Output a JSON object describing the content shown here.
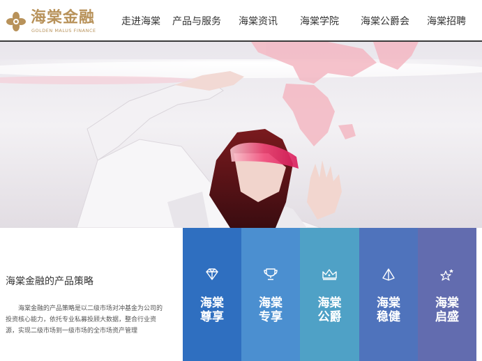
{
  "logo": {
    "name_cn": "海棠金融",
    "name_en": "GOLDEN MALUS FINANCE"
  },
  "nav": [
    {
      "label": "走进海棠"
    },
    {
      "label": "产品与服务"
    },
    {
      "label": "海棠资讯"
    },
    {
      "label": "海棠学院"
    },
    {
      "label": "海棠公爵会"
    },
    {
      "label": "海棠招聘"
    }
  ],
  "strategy": {
    "title": "海棠金融的产品策略",
    "text": "海棠金融的产品策略是以二级市场对冲基金为公司的投资核心能力，依托专业私募投顾大数据，整合行业资源，实现二级市场到一级市场的全市场资产管理"
  },
  "products": [
    {
      "line1": "海棠",
      "line2": "尊享",
      "icon": "diamond-icon",
      "color": "#2f6fc0"
    },
    {
      "line1": "海棠",
      "line2": "专享",
      "icon": "trophy-icon",
      "color": "#4b8fd0"
    },
    {
      "line1": "海棠",
      "line2": "公爵",
      "icon": "crown-icon",
      "color": "#4fa1c6"
    },
    {
      "line1": "海棠",
      "line2": "稳健",
      "icon": "pyramid-icon",
      "color": "#4f73bc"
    },
    {
      "line1": "海棠",
      "line2": "启盛",
      "icon": "stars-icon",
      "color": "#626caf"
    }
  ],
  "colors": {
    "brand_gold": "#b8925a",
    "header_border": "#3a3a3a"
  }
}
